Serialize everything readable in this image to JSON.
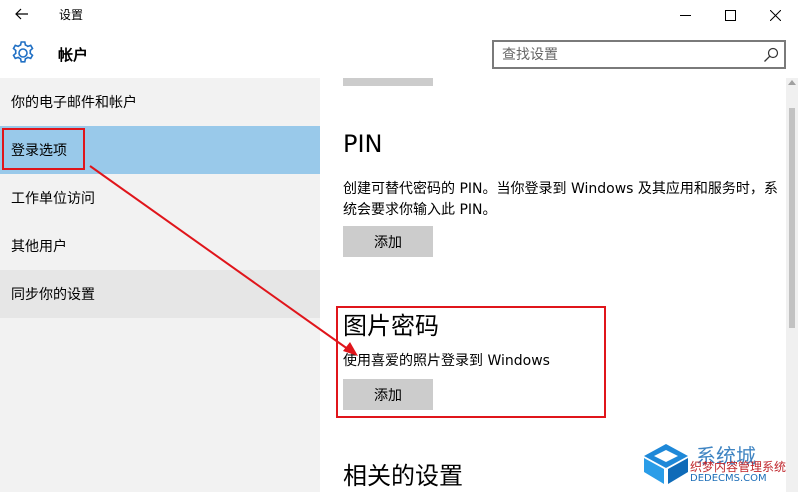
{
  "window": {
    "title": "设置"
  },
  "header": {
    "app_title": "帐户",
    "search_placeholder": "查找设置"
  },
  "sidebar": {
    "items": [
      {
        "label": "你的电子邮件和帐户"
      },
      {
        "label": "登录选项"
      },
      {
        "label": "工作单位访问"
      },
      {
        "label": "其他用户"
      },
      {
        "label": "同步你的设置"
      }
    ]
  },
  "main": {
    "pin": {
      "title": "PIN",
      "description": "创建可替代密码的 PIN。当你登录到 Windows 及其应用和服务时，系统会要求你输入此 PIN。",
      "button": "添加"
    },
    "picture_password": {
      "title": "图片密码",
      "description": "使用喜爱的照片登录到 Windows",
      "button": "添加"
    },
    "related": {
      "title": "相关的设置"
    }
  },
  "watermark": {
    "line1": "系统城",
    "line2": "织梦内容管理系统",
    "line3": "DEDECMS.COM"
  },
  "colors": {
    "selected_nav": "#99c9ea",
    "highlight_red": "#e0151b",
    "button_gray": "#cccccc"
  }
}
